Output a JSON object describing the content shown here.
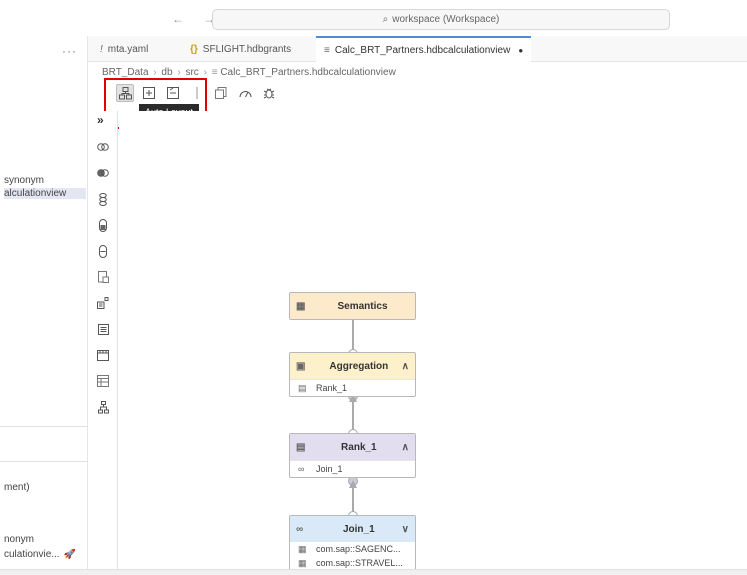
{
  "titlebar": {
    "nav": "← →",
    "search_text": "workspace (Workspace)"
  },
  "explorer": {
    "more": "···",
    "items": [
      {
        "label": "synonym"
      },
      {
        "label": "alculationview"
      },
      {
        "label": "ment)"
      },
      {
        "label": "nonym"
      },
      {
        "label": "culationvie..."
      }
    ]
  },
  "tabs": [
    {
      "icon": "!",
      "label": "mta.yaml"
    },
    {
      "icon": "{}",
      "label": "SFLIGHT.hdbgrants"
    },
    {
      "icon": "≡",
      "label": "Calc_BRT_Partners.hdbcalculationview",
      "dirty": "●"
    }
  ],
  "breadcrumb": {
    "items": [
      "BRT_Data",
      "db",
      "src",
      "Calc_BRT_Partners.hdbcalculationview"
    ],
    "sep": "›",
    "file_icon": "≡"
  },
  "toolbar": {
    "tooltip": "Auto Layout"
  },
  "palette": {
    "expand": "»"
  },
  "nodes": {
    "semantics": {
      "title": "Semantics"
    },
    "aggregation": {
      "title": "Aggregation",
      "rows": [
        "Rank_1"
      ]
    },
    "rank": {
      "title": "Rank_1",
      "rows": [
        "Join_1"
      ]
    },
    "join": {
      "title": "Join_1",
      "rows": [
        "com.sap::SAGENC...",
        "com.sap::STRAVEL..."
      ]
    }
  },
  "colors": {
    "semantics_header": "#fdeacb",
    "aggregation_header": "#fdf1cc",
    "rank_header": "#e2def0",
    "join_header": "#d9e9f7",
    "highlight_box": "#e00000",
    "active_tab_accent": "#4a8fd6"
  }
}
